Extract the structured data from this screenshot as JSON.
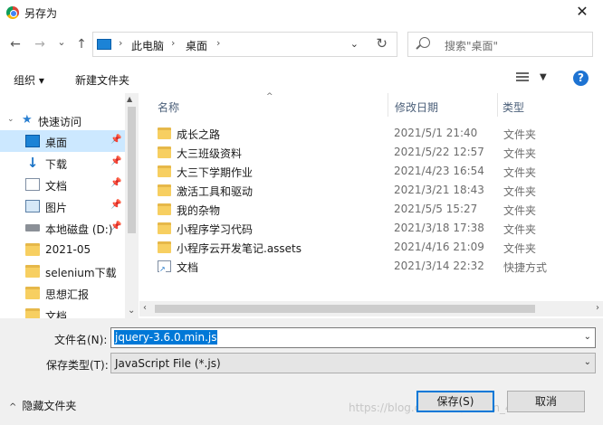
{
  "window": {
    "title": "另存为",
    "close_glyph": "✕"
  },
  "nav": {
    "back": "←",
    "forward": "→",
    "recent": "⌄",
    "up": "↑",
    "breadcrumb": [
      "此电脑",
      "桌面"
    ],
    "search_placeholder": "搜索\"桌面\""
  },
  "toolbar": {
    "organize": "组织 ▾",
    "new_folder": "新建文件夹",
    "help": "?"
  },
  "sidebar": {
    "items": [
      {
        "label": "快速访问",
        "icon": "star-icon",
        "pinned": false
      },
      {
        "label": "桌面",
        "icon": "desktop-icon",
        "pinned": true,
        "selected": true
      },
      {
        "label": "下载",
        "icon": "download-icon",
        "pinned": true
      },
      {
        "label": "文档",
        "icon": "document-icon",
        "pinned": true
      },
      {
        "label": "图片",
        "icon": "picture-icon",
        "pinned": true
      },
      {
        "label": "本地磁盘 (D:)",
        "icon": "drive-icon",
        "pinned": true
      },
      {
        "label": "2021-05",
        "icon": "folder-icon",
        "pinned": false
      },
      {
        "label": "selenium下载",
        "icon": "folder-icon",
        "pinned": false
      },
      {
        "label": "思想汇报",
        "icon": "folder-icon",
        "pinned": false
      },
      {
        "label": "文档",
        "icon": "folder-icon",
        "pinned": false
      }
    ]
  },
  "columns": {
    "name": "名称",
    "date": "修改日期",
    "type": "类型"
  },
  "files": [
    {
      "name": "成长之路",
      "date": "2021/5/1 21:40",
      "type": "文件夹",
      "icon": "folder-icon"
    },
    {
      "name": "大三班级资料",
      "date": "2021/5/22 12:57",
      "type": "文件夹",
      "icon": "folder-icon"
    },
    {
      "name": "大三下学期作业",
      "date": "2021/4/23 16:54",
      "type": "文件夹",
      "icon": "folder-icon"
    },
    {
      "name": "激活工具和驱动",
      "date": "2021/3/21 18:43",
      "type": "文件夹",
      "icon": "folder-icon"
    },
    {
      "name": "我的杂物",
      "date": "2021/5/5 15:27",
      "type": "文件夹",
      "icon": "folder-icon"
    },
    {
      "name": "小程序学习代码",
      "date": "2021/3/18 17:38",
      "type": "文件夹",
      "icon": "folder-icon"
    },
    {
      "name": "小程序云开发笔记.assets",
      "date": "2021/4/16 21:09",
      "type": "文件夹",
      "icon": "folder-icon"
    },
    {
      "name": "文档",
      "date": "2021/3/14 22:32",
      "type": "快捷方式",
      "icon": "shortcut-icon"
    }
  ],
  "form": {
    "filename_label": "文件名(N):",
    "filename_value": "jquery-3.6.0.min.js",
    "filetype_label": "保存类型(T):",
    "filetype_value": "JavaScript File (*.js)",
    "hide_folders": "隐藏文件夹",
    "save": "保存(S)",
    "cancel": "取消"
  },
  "watermark": "https://blog.csdn.net/weixin_49811023"
}
